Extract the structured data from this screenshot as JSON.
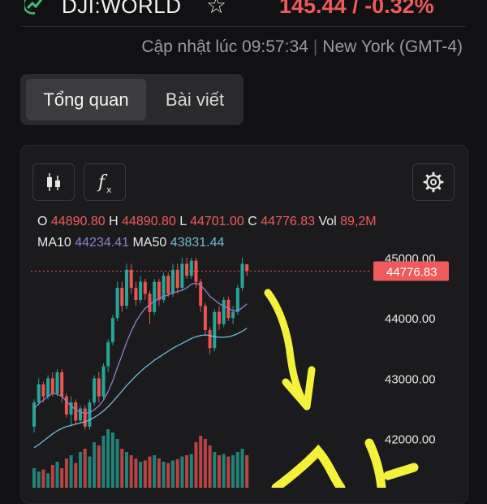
{
  "header": {
    "symbol": "DJI:WORLD",
    "change": "145.44 / -0.32%"
  },
  "update": {
    "label": "Cập nhật lúc 09:57:34",
    "timezone": "New York (GMT-4)"
  },
  "tabs": [
    {
      "label": "Tổng quan",
      "active": true
    },
    {
      "label": "Bài viết",
      "active": false
    }
  ],
  "toolbar": {
    "icons": [
      "candlestick-icon",
      "fx-indicator-icon",
      "gear-icon"
    ]
  },
  "ohlc": {
    "o_label": "O",
    "o_value": "44890.80",
    "h_label": "H",
    "h_value": "44890.80",
    "l_label": "L",
    "l_value": "44701.00",
    "c_label": "C",
    "c_value": "44776.83",
    "vol_label": "Vol",
    "vol_value": "89,2M"
  },
  "ma": {
    "ma10_label": "MA10",
    "ma10_value": "44234.41",
    "ma50_label": "MA50",
    "ma50_value": "43831.44"
  },
  "colors": {
    "up": "#26a69a",
    "down": "#ef5350",
    "ma10": "#8d7fd1",
    "ma50": "#74b9d8",
    "annotation": "#f5f03a"
  },
  "chart_data": {
    "type": "candlestick",
    "current_price": 44776.83,
    "current_price_label": "44776.83",
    "y_ticks": [
      {
        "value": 45000,
        "label": "45000.00"
      },
      {
        "value": 44000,
        "label": "44000.00"
      },
      {
        "value": 43000,
        "label": "43000.00"
      },
      {
        "value": 42000,
        "label": "42000.00"
      }
    ],
    "candles": [
      [
        42200,
        42600,
        42100,
        42650
      ],
      [
        42600,
        42900,
        42550,
        43000
      ],
      [
        42900,
        42700,
        42600,
        42950
      ],
      [
        42700,
        43000,
        42650,
        43050
      ],
      [
        43000,
        42750,
        42700,
        43100
      ],
      [
        42750,
        43100,
        42700,
        43150
      ],
      [
        43100,
        42700,
        42600,
        43150
      ],
      [
        42700,
        42400,
        42350,
        42750
      ],
      [
        42400,
        42600,
        42200,
        42700
      ],
      [
        42600,
        42300,
        42250,
        42650
      ],
      [
        42300,
        42500,
        42250,
        42550
      ],
      [
        42500,
        42200,
        42150,
        42550
      ],
      [
        42200,
        42600,
        42150,
        42650
      ],
      [
        42600,
        43000,
        42550,
        43050
      ],
      [
        43000,
        42700,
        42600,
        43100
      ],
      [
        42700,
        43200,
        42650,
        43250
      ],
      [
        43200,
        43600,
        43100,
        43650
      ],
      [
        43600,
        44000,
        43550,
        44050
      ],
      [
        44000,
        44500,
        43950,
        44600
      ],
      [
        44500,
        44200,
        44100,
        44600
      ],
      [
        44200,
        44800,
        44150,
        44900
      ],
      [
        44800,
        44500,
        44400,
        44900
      ],
      [
        44500,
        44300,
        44200,
        44600
      ],
      [
        44300,
        44600,
        44250,
        44700
      ],
      [
        44600,
        44400,
        44300,
        44650
      ],
      [
        44400,
        44100,
        43900,
        44450
      ],
      [
        44100,
        44600,
        44050,
        44650
      ],
      [
        44600,
        44300,
        44200,
        44650
      ],
      [
        44300,
        44700,
        44250,
        44750
      ],
      [
        44700,
        44400,
        44350,
        44750
      ],
      [
        44400,
        44800,
        44350,
        44900
      ],
      [
        44800,
        44500,
        44400,
        44900
      ],
      [
        44500,
        44900,
        44450,
        45000
      ],
      [
        44900,
        44700,
        44650,
        45000
      ],
      [
        44700,
        44950,
        44650,
        45000
      ],
      [
        44950,
        44600,
        44500,
        45000
      ],
      [
        44600,
        44200,
        44100,
        44650
      ],
      [
        44200,
        43800,
        43700,
        44250
      ],
      [
        43800,
        43500,
        43400,
        43850
      ],
      [
        43500,
        44100,
        43450,
        44150
      ],
      [
        44100,
        43900,
        43800,
        44200
      ],
      [
        43900,
        44300,
        43850,
        44350
      ],
      [
        44300,
        44000,
        43950,
        44350
      ],
      [
        44000,
        44100,
        43900,
        44200
      ],
      [
        44100,
        44500,
        44050,
        44550
      ],
      [
        44500,
        44900,
        44450,
        45000
      ],
      [
        44890.8,
        44776.83,
        44701,
        44890.8
      ]
    ],
    "ma10": [
      42500,
      42580,
      42640,
      42700,
      42750,
      42740,
      42700,
      42620,
      42540,
      42480,
      42440,
      42420,
      42430,
      42480,
      42540,
      42640,
      42780,
      42960,
      43180,
      43380,
      43600,
      43780,
      43940,
      44060,
      44160,
      44220,
      44280,
      44320,
      44360,
      44380,
      44420,
      44440,
      44460,
      44500,
      44560,
      44580,
      44540,
      44460,
      44360,
      44300,
      44240,
      44200,
      44160,
      44120,
      44120,
      44170,
      44234.41
    ],
    "ma50": [
      41850,
      41900,
      41960,
      42020,
      42080,
      42130,
      42170,
      42200,
      42220,
      42240,
      42260,
      42280,
      42310,
      42350,
      42400,
      42460,
      42530,
      42610,
      42700,
      42790,
      42880,
      42960,
      43040,
      43110,
      43180,
      43240,
      43300,
      43350,
      43400,
      43450,
      43500,
      43540,
      43580,
      43620,
      43660,
      43690,
      43710,
      43720,
      43710,
      43690,
      43680,
      43680,
      43690,
      43710,
      43740,
      43780,
      43831.44
    ],
    "volume": [
      0.3,
      0.25,
      0.28,
      0.22,
      0.35,
      0.4,
      0.3,
      0.45,
      0.5,
      0.38,
      0.55,
      0.6,
      0.48,
      0.7,
      0.65,
      0.8,
      0.9,
      0.85,
      0.75,
      0.6,
      0.55,
      0.5,
      0.45,
      0.4,
      0.42,
      0.48,
      0.5,
      0.45,
      0.4,
      0.38,
      0.42,
      0.44,
      0.48,
      0.5,
      0.52,
      0.7,
      0.8,
      0.75,
      0.65,
      0.55,
      0.5,
      0.52,
      0.48,
      0.5,
      0.55,
      0.6,
      0.5
    ]
  }
}
